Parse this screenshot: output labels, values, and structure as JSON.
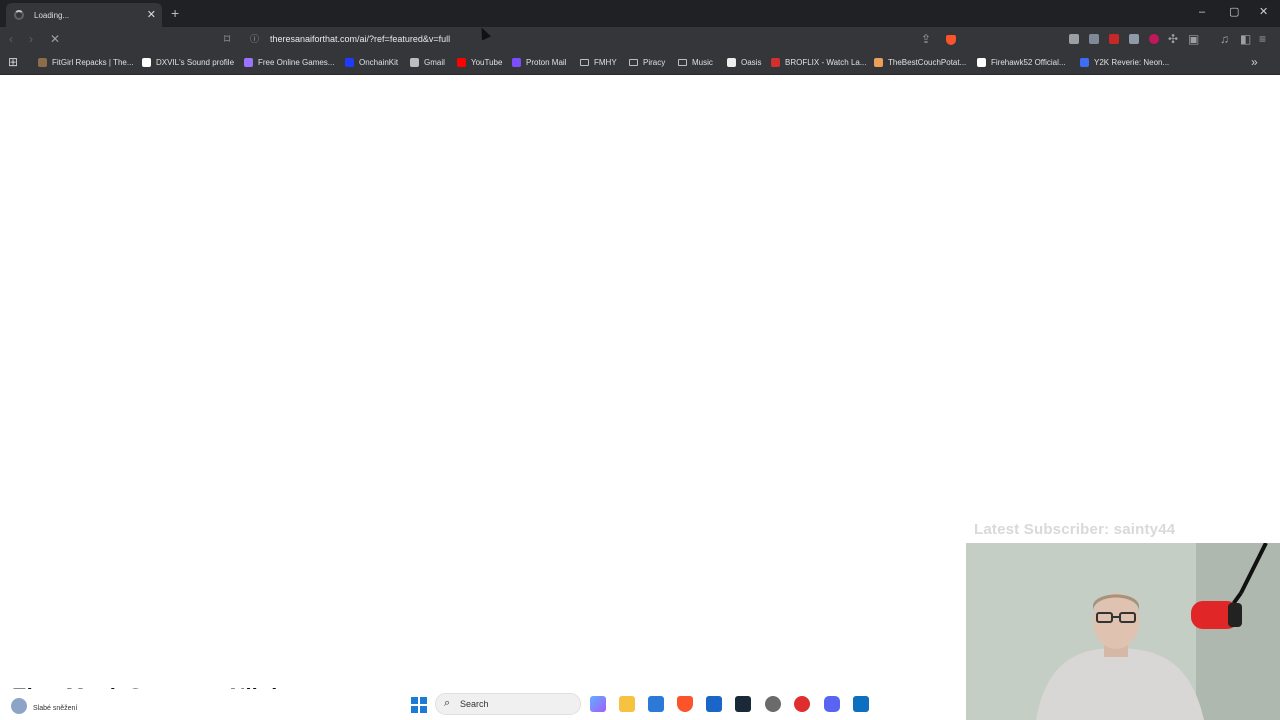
{
  "browser": {
    "tab": {
      "title": "Loading...",
      "close": "✕"
    },
    "new_tab": "+",
    "window_controls": {
      "minimize": "–",
      "maximize": "▢",
      "close": "✕"
    },
    "address_bar": {
      "url": "theresanaiforthat.com/ai/?ref=featured&v=full"
    },
    "bookmarks": [
      {
        "label": "FitGirl Repacks | The...",
        "color": "#8b6d4a"
      },
      {
        "label": "DXVIL's Sound profile",
        "color": "#ffffff"
      },
      {
        "label": "Free Online Games...",
        "color": "#9b73ff"
      },
      {
        "label": "OnchainKit",
        "color": "#1f3bff"
      },
      {
        "label": "Gmail",
        "color": "#bdbdbd"
      },
      {
        "label": "YouTube",
        "color": "#ff0000"
      },
      {
        "label": "Proton Mail",
        "color": "#7c4dff"
      },
      {
        "label": "FMHY",
        "folder": true
      },
      {
        "label": "Piracy",
        "folder": true
      },
      {
        "label": "Music",
        "folder": true
      },
      {
        "label": "Oasis",
        "color": "#eeeeee"
      },
      {
        "label": "BROFLIX - Watch La...",
        "color": "#d32f2f"
      },
      {
        "label": "TheBestCouchPotat...",
        "color": "#e9a05a"
      },
      {
        "label": "Firehawk52 Official...",
        "color": "#ffffff"
      },
      {
        "label": "Y2K Reverie: Neon...",
        "color": "#3d6df2"
      }
    ],
    "more_bookmarks": "»"
  },
  "overlay": {
    "latest_subscriber": "Latest Subscriber: sainty44",
    "ticker": "Elon Musk Streamu: Nikdo"
  },
  "taskbar": {
    "weather": "Slabé sněžení",
    "search_label": "Search"
  }
}
